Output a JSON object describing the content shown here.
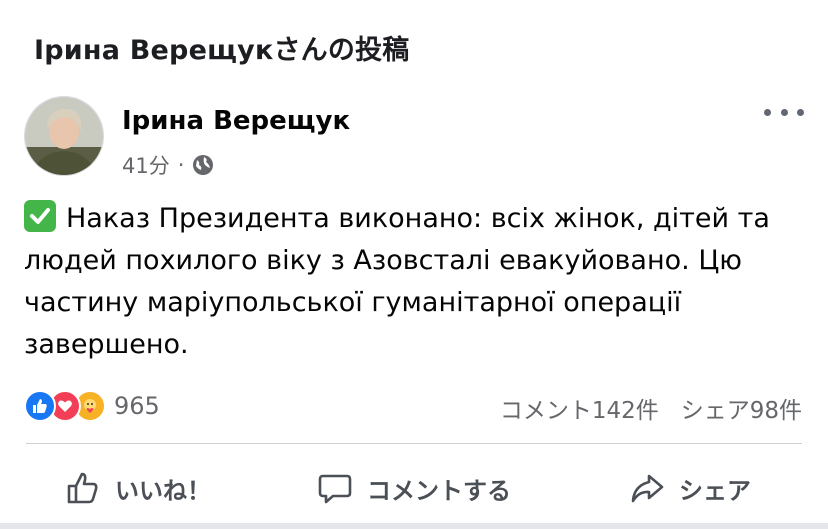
{
  "page": {
    "title": "Ірина Верещукさんの投稿"
  },
  "post": {
    "author": "Ірина Верещук",
    "time": "41分",
    "separator": "·",
    "privacy_icon": "globe-icon",
    "body_icon": "check-mark-button-emoji",
    "body": "Наказ Президента виконано: всіх жінок, дітей та людей похилого віку з Азовсталі евакуйовано. Цю частину маріупольської гуманітарної операції завершено.",
    "reaction_icons": [
      "like-icon",
      "love-icon",
      "care-icon"
    ],
    "reactions_count": "965",
    "comments_count": "コメント142件",
    "shares_count": "シェア98件"
  },
  "actions": {
    "like_label": "いいね！",
    "comment_label": "コメントする",
    "share_label": "シェア"
  },
  "colors": {
    "like": "#1877f2",
    "love": "#f33e58",
    "care": "#f7b125",
    "check": "#44b549",
    "secondary_text": "#65676b"
  }
}
